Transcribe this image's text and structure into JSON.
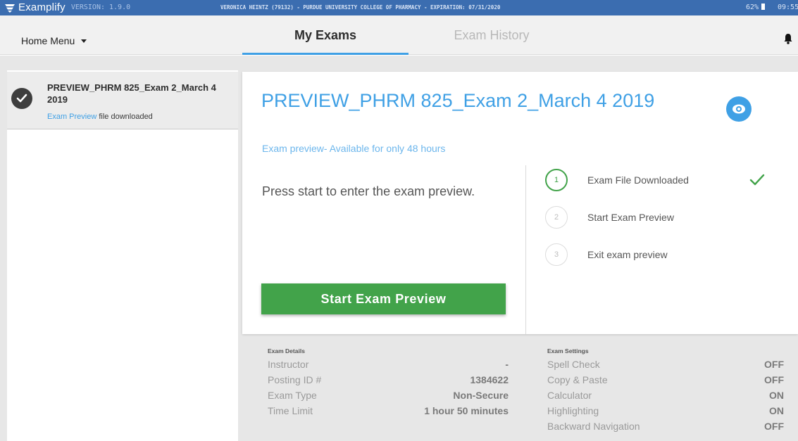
{
  "system_bar": {
    "brand": "Examplify",
    "version": "VERSION: 1.9.0",
    "license": "VERONICA HEINTZ (79132) - PURDUE UNIVERSITY COLLEGE OF PHARMACY - EXPIRATION: 07/31/2020",
    "battery": "62%",
    "time": "09:55",
    "colors": {
      "bar": "#3b6db0"
    }
  },
  "nav": {
    "home_menu": "Home Menu",
    "tabs": [
      {
        "label": "My Exams",
        "active": true
      },
      {
        "label": "Exam History",
        "active": false
      }
    ],
    "bell_icon": "bell-icon"
  },
  "sidebar": {
    "items": [
      {
        "title": "PREVIEW_PHRM 825_Exam 2_March 4 2019",
        "status_link": "Exam Preview",
        "status_text": " file downloaded",
        "icon": "check-circle-icon"
      }
    ]
  },
  "exam_card": {
    "title": "PREVIEW_PHRM 825_Exam 2_March 4 2019",
    "availability": "Exam preview- Available for only 48 hours",
    "instructions": "Press start to enter the exam preview.",
    "start_button": "Start Exam Preview",
    "eye_icon": "eye-icon",
    "steps": [
      {
        "number": "1",
        "label": "Exam File Downloaded",
        "done": true
      },
      {
        "number": "2",
        "label": "Start Exam Preview",
        "done": false
      },
      {
        "number": "3",
        "label": "Exit exam preview",
        "done": false
      }
    ],
    "colors": {
      "accent": "#3fa0e5",
      "success": "#42a34a"
    }
  },
  "exam_details": {
    "heading": "Exam Details",
    "rows": [
      {
        "label": "Instructor",
        "value": "-"
      },
      {
        "label": "Posting ID #",
        "value": "1384622"
      },
      {
        "label": "Exam Type",
        "value": "Non-Secure"
      },
      {
        "label": "Time Limit",
        "value": "1 hour 50 minutes"
      }
    ]
  },
  "exam_settings": {
    "heading": "Exam Settings",
    "rows": [
      {
        "label": "Spell Check",
        "value": "OFF"
      },
      {
        "label": "Copy & Paste",
        "value": "OFF"
      },
      {
        "label": "Calculator",
        "value": "ON"
      },
      {
        "label": "Highlighting",
        "value": "ON"
      },
      {
        "label": "Backward Navigation",
        "value": "OFF"
      }
    ]
  }
}
